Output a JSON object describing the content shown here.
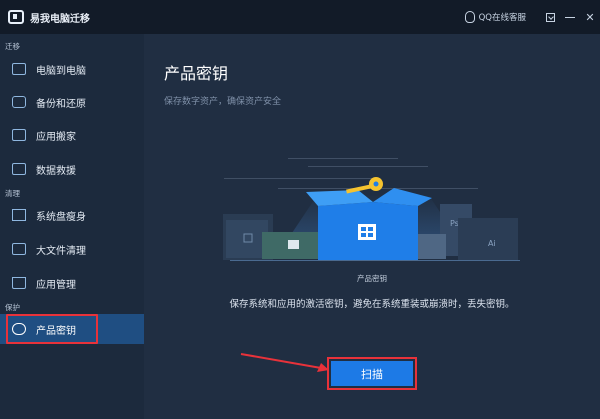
{
  "window": {
    "app_title": "易我电脑迁移",
    "support_label": "QQ在线客服"
  },
  "sidebar": {
    "sections": [
      {
        "label": "迁移",
        "items": [
          {
            "label": "电脑到电脑"
          },
          {
            "label": "备份和还原"
          },
          {
            "label": "应用搬家"
          },
          {
            "label": "数据救援"
          }
        ]
      },
      {
        "label": "清理",
        "items": [
          {
            "label": "系统盘瘦身"
          },
          {
            "label": "大文件清理"
          },
          {
            "label": "应用管理"
          }
        ]
      },
      {
        "label": "保护",
        "items": [
          {
            "label": "产品密钥",
            "active": true
          }
        ]
      }
    ]
  },
  "main": {
    "title": "产品密钥",
    "subtitle": "保存数字资产，确保资产安全",
    "illustration_caption": "产品密钥",
    "description": "保存系统和应用的激活密钥，避免在系统重装或崩溃时，丢失密钥。",
    "scan_button_label": "扫描"
  },
  "colors": {
    "accent": "#1d7ae6",
    "active_nav": "#1f4e82",
    "highlight_red": "#e8323a"
  }
}
